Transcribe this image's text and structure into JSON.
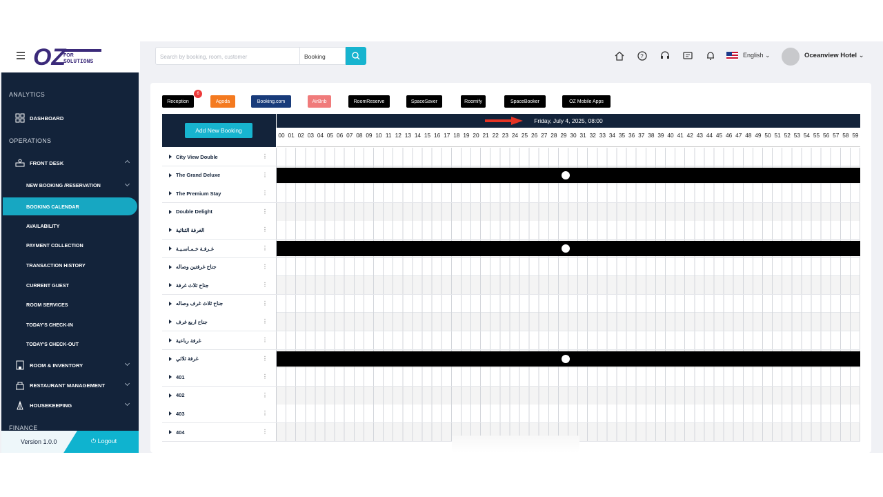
{
  "sidebar": {
    "brand": "FOR SOLUTIONS",
    "section_analytics": "ANALYTICS",
    "dashboard": "DASHBOARD",
    "section_operations": "OPERATIONS",
    "front_desk": "FRONT DESK",
    "sub_items": [
      "NEW BOOKING /RESERVATION",
      "BOOKING CALENDAR",
      "AVAILABILITY",
      "PAYMENT COLLECTION",
      "TRANSACTION HISTORY",
      "CURRENT GUEST",
      "ROOM SERVICES",
      "TODAY'S CHECK-IN",
      "TODAY'S CHECK-OUT"
    ],
    "room_inventory": "ROOM & INVENTORY",
    "restaurant": "RESTAURANT MANAGEMENT",
    "housekeeping": "HOUSEKEEPING",
    "section_finance": "FINANCE",
    "version": "Version 1.0.0",
    "logout": "Logout"
  },
  "header": {
    "search_placeholder": "Search by booking, room, customer",
    "search_type": "Booking",
    "language": "English",
    "hotel": "Oceanview Hotel"
  },
  "channels": [
    {
      "label": "Reception",
      "color": "#000000"
    },
    {
      "label": "Agoda",
      "color": "#f47a20"
    },
    {
      "label": "Booking.com",
      "color": "#183b7a"
    },
    {
      "label": "AirBnb",
      "color": "#f07b7b"
    },
    {
      "label": "RoomReserve",
      "color": "#000000"
    },
    {
      "label": "SpaceSaver",
      "color": "#000000"
    },
    {
      "label": "Roomify",
      "color": "#000000"
    },
    {
      "label": "SpaceBooker",
      "color": "#000000"
    },
    {
      "label": "OZ Mobile Apps",
      "color": "#000000"
    }
  ],
  "reception_badge": "6",
  "calendar": {
    "add_button": "Add New Booking",
    "date_label": "Friday, July 4, 2025, 08:00",
    "hours": [
      "00",
      "01",
      "02",
      "03",
      "04",
      "05",
      "06",
      "07",
      "08",
      "09",
      "10",
      "11",
      "12",
      "13",
      "14",
      "15",
      "16",
      "17",
      "18",
      "19",
      "20",
      "21",
      "22",
      "23",
      "24",
      "25",
      "26",
      "27",
      "28",
      "29",
      "30",
      "31",
      "32",
      "33",
      "34",
      "35",
      "36",
      "37",
      "38",
      "39",
      "40",
      "41",
      "42",
      "43",
      "44",
      "45",
      "46",
      "47",
      "48",
      "49",
      "50",
      "51",
      "52",
      "53",
      "54",
      "55",
      "56",
      "57",
      "58",
      "59"
    ],
    "rooms": [
      {
        "name": "City View Double",
        "blocked": false
      },
      {
        "name": "The Grand Deluxe",
        "blocked": true
      },
      {
        "name": "The Premium Stay",
        "blocked": false
      },
      {
        "name": "Double Delight",
        "blocked": false
      },
      {
        "name": "الغرفة الثنائية",
        "blocked": false
      },
      {
        "name": "غـرفـة خـمـاسـيـة",
        "blocked": true
      },
      {
        "name": "جناح غرفتين وصاله",
        "blocked": false
      },
      {
        "name": "جناح ثلاث غرفة",
        "blocked": false
      },
      {
        "name": "جناح ثلاث غرف وصاله",
        "blocked": false
      },
      {
        "name": "جناح اربع غرف",
        "blocked": false
      },
      {
        "name": "غرفة رباعية",
        "blocked": false
      },
      {
        "name": "غرفة ثلاثي",
        "blocked": true
      },
      {
        "name": "401",
        "blocked": false
      },
      {
        "name": "402",
        "blocked": false
      },
      {
        "name": "403",
        "blocked": false
      },
      {
        "name": "404",
        "blocked": false
      }
    ]
  }
}
